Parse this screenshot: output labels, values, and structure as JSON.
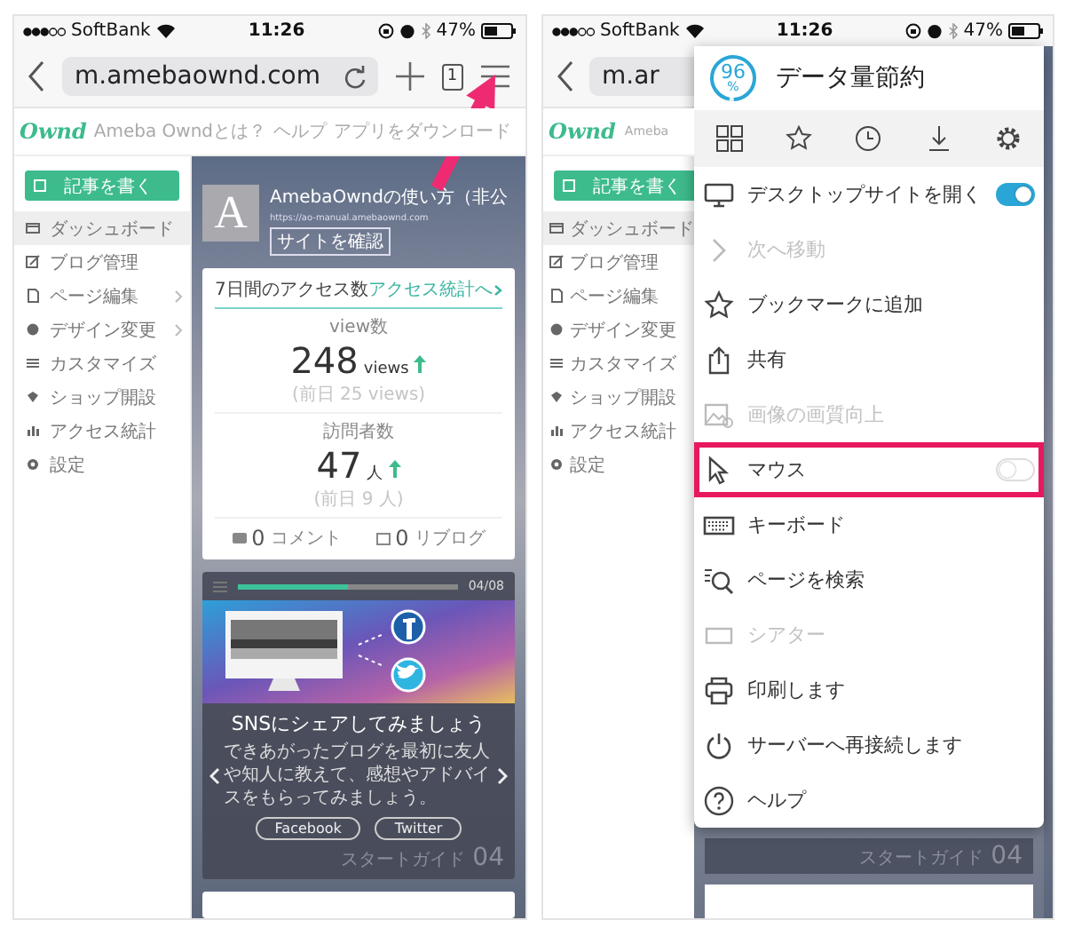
{
  "left_phone": {
    "status_bar": {
      "carrier": "SoftBank",
      "time": "11:26",
      "battery": "47%"
    },
    "toolbar": {
      "url": "m.amebaownd.com",
      "tab_count": "1"
    },
    "site_header": {
      "logo": "Ownd",
      "links": [
        "Ameba Owndとは？",
        "ヘルプ",
        "アプリをダウンロード"
      ]
    },
    "sidebar": {
      "write_button": "記事を書く",
      "items": [
        {
          "label": "ダッシュボード",
          "selected": true,
          "has_submenu": false
        },
        {
          "label": "ブログ管理",
          "selected": false,
          "has_submenu": false
        },
        {
          "label": "ページ編集",
          "selected": false,
          "has_submenu": true
        },
        {
          "label": "デザイン変更",
          "selected": false,
          "has_submenu": true
        },
        {
          "label": "カスタマイズ",
          "selected": false,
          "has_submenu": false
        },
        {
          "label": "ショップ開設",
          "selected": false,
          "has_submenu": false
        },
        {
          "label": "アクセス統計",
          "selected": false,
          "has_submenu": false
        },
        {
          "label": "設定",
          "selected": false,
          "has_submenu": false
        }
      ]
    },
    "blog": {
      "avatar": "A",
      "title": "AmebaOwndの使い方（非公",
      "url": "https://ao-manual.amebaownd.com",
      "site_button": "サイトを確認"
    },
    "access_card": {
      "title": "7日間のアクセス数",
      "link": "アクセス統計へ",
      "stats": [
        {
          "label": "view数",
          "value": "248",
          "unit": "views",
          "previous": "(前日 25 views)"
        },
        {
          "label": "訪問者数",
          "value": "47",
          "unit": "人",
          "previous": "(前日 9 人)"
        }
      ],
      "footer": [
        {
          "count": "0",
          "label": "コメント"
        },
        {
          "count": "0",
          "label": "リブログ"
        }
      ]
    },
    "guide_card": {
      "progress": {
        "level": 0.5,
        "reading": "04/08"
      },
      "title": "SNSにシェアしてみましょう",
      "body": "できあがったブログを最初に友人や知人に教えて、感想やアドバイスをもらってみましょう。",
      "buttons": [
        "Facebook",
        "Twitter"
      ],
      "footer_label": "スタートガイド",
      "footer_number": "04"
    }
  },
  "right_phone": {
    "status_bar": {
      "carrier": "SoftBank",
      "time": "11:26",
      "battery": "47%"
    },
    "toolbar": {
      "url": "m.ar"
    },
    "site_header": {
      "logo": "Ownd",
      "tagline": "Ameba"
    },
    "sidebar": {
      "write_button": "記事を書く",
      "items": [
        {
          "label": "ダッシュボード",
          "selected": true
        },
        {
          "label": "ブログ管理",
          "selected": false
        },
        {
          "label": "ページ編集",
          "selected": false
        },
        {
          "label": "デザイン変更",
          "selected": false
        },
        {
          "label": "カスタマイズ",
          "selected": false
        },
        {
          "label": "ショップ開設",
          "selected": false
        },
        {
          "label": "アクセス統計",
          "selected": false
        },
        {
          "label": "設定",
          "selected": false
        }
      ]
    },
    "menu": {
      "saver": {
        "percent": "96",
        "unit": "%",
        "level": 0.96,
        "label": "データ量節約"
      },
      "items": [
        {
          "kind": "toggle",
          "label": "デスクトップサイトを開く",
          "disabled": false,
          "on": true,
          "highlighted": false
        },
        {
          "kind": "action",
          "label": "次へ移動",
          "disabled": true,
          "highlighted": false
        },
        {
          "kind": "action",
          "label": "ブックマークに追加",
          "disabled": false,
          "highlighted": false
        },
        {
          "kind": "action",
          "label": "共有",
          "disabled": false,
          "highlighted": false
        },
        {
          "kind": "action",
          "label": "画像の画質向上",
          "disabled": true,
          "highlighted": false
        },
        {
          "kind": "toggle",
          "label": "マウス",
          "disabled": false,
          "on": false,
          "highlighted": true
        },
        {
          "kind": "action",
          "label": "キーボード",
          "disabled": false,
          "highlighted": false
        },
        {
          "kind": "action",
          "label": "ページを検索",
          "disabled": false,
          "highlighted": false
        },
        {
          "kind": "action",
          "label": "シアター",
          "disabled": true,
          "highlighted": false
        },
        {
          "kind": "action",
          "label": "印刷します",
          "disabled": false,
          "highlighted": false
        },
        {
          "kind": "action",
          "label": "サーバーへ再接続します",
          "disabled": false,
          "highlighted": false
        },
        {
          "kind": "action",
          "label": "ヘルプ",
          "disabled": false,
          "highlighted": false
        }
      ]
    },
    "footer": {
      "label": "スタートガイド",
      "number": "04"
    }
  }
}
